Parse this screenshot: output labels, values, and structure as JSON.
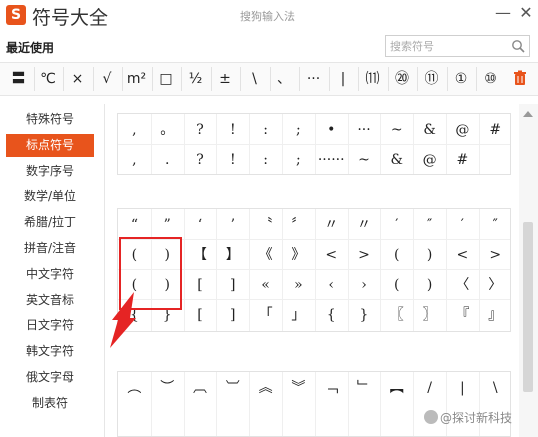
{
  "app": {
    "logo": "S",
    "title": "符号大全",
    "subtitle": "搜狗输入法"
  },
  "window": {
    "minimize": "—",
    "close": "✕"
  },
  "recent": {
    "label": "最近使用",
    "symbols": [
      "〓",
      "℃",
      "×",
      "√",
      "m²",
      "□",
      "½",
      "±",
      "\\",
      "、",
      "···",
      "|",
      "⑾",
      "⑳",
      "⑪",
      "①",
      "⑩"
    ]
  },
  "search": {
    "placeholder": "搜索符号"
  },
  "sidebar": {
    "items": [
      "特殊符号",
      "标点符号",
      "数字序号",
      "数学/单位",
      "希腊/拉丁",
      "拼音/注音",
      "中文字符",
      "英文音标",
      "日文字符",
      "韩文字符",
      "俄文字母",
      "制表符"
    ],
    "active_index": 1
  },
  "grid1": {
    "rows": [
      [
        ",",
        "。",
        "?",
        "!",
        ":",
        ";",
        "•",
        "···",
        "~",
        "&",
        "@",
        "#"
      ],
      [
        ",",
        ".",
        "?",
        "!",
        ":",
        ";",
        "······",
        "~",
        "&",
        "@",
        "#"
      ]
    ]
  },
  "grid2": {
    "rows": [
      [
        "“",
        "”",
        "‘",
        "’",
        "〝",
        "〞",
        "〃",
        "〃",
        "′",
        "″",
        "′",
        "″"
      ],
      [
        "(",
        ")",
        "【",
        "】",
        "《",
        "》",
        "<",
        ">",
        "(",
        ")",
        "<",
        ">"
      ],
      [
        "(",
        ")",
        "[",
        "]",
        "«",
        "»",
        "‹",
        "›",
        "(",
        ")",
        "〈",
        "〉"
      ],
      [
        "{",
        "}",
        "[",
        "]",
        "「",
        "」",
        "{",
        "}",
        "〖",
        "〗",
        "『",
        "』"
      ]
    ]
  },
  "grid3": {
    "rows": [
      [
        "︵",
        "︶",
        "︹",
        "︺",
        "︽",
        "︾",
        "﹁",
        "﹂",
        "︻",
        "/",
        "|",
        "\\"
      ]
    ]
  },
  "watermark": "@探讨新科技"
}
